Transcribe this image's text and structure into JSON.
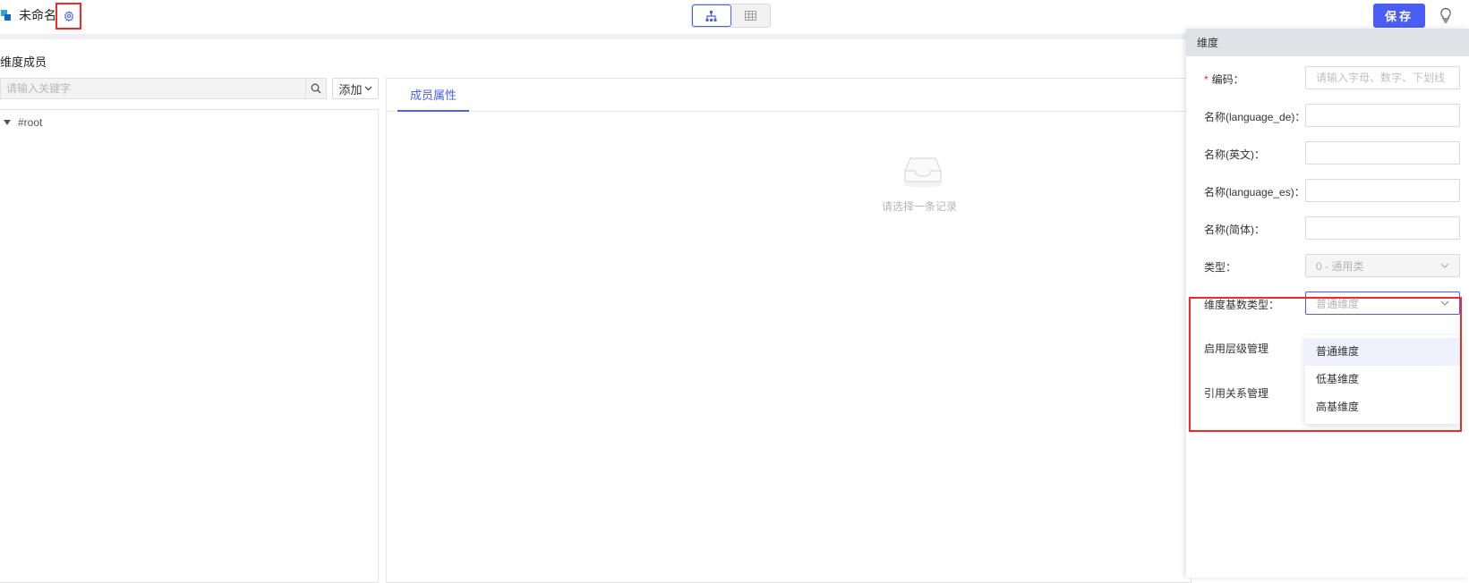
{
  "header": {
    "title": "未命名",
    "save_label": "保存",
    "colors": {
      "accent": "#4b5ef4",
      "highlight": "#f02a2a"
    },
    "icons": [
      "cube-logo-icon",
      "gear-icon",
      "tree-view-icon",
      "table-view-icon",
      "lightbulb-icon"
    ]
  },
  "left_panel": {
    "title": "维度成员",
    "search": {
      "placeholder": "请输入关键字",
      "value": ""
    },
    "add_label": "添加",
    "tree": [
      {
        "label": "#root",
        "expanded": true
      }
    ]
  },
  "detail": {
    "tabs": [
      {
        "label": "成员属性",
        "active": true
      }
    ],
    "empty_text": "请选择一条记录"
  },
  "drawer": {
    "title": "维度",
    "fields": [
      {
        "label": "编码：",
        "required": true,
        "placeholder": "请输入字母、数字、下划线",
        "value": ""
      },
      {
        "label": "名称(language_de)：",
        "value": ""
      },
      {
        "label": "名称(英文)：",
        "value": ""
      },
      {
        "label": "名称(language_es)：",
        "value": ""
      },
      {
        "label": "名称(简体)：",
        "value": ""
      },
      {
        "label": "类型：",
        "value": "0 - 通用类",
        "disabled": true
      },
      {
        "label": "维度基数类型：",
        "value": "普通维度",
        "focused": true
      },
      {
        "label": "启用层级管理"
      },
      {
        "label": "引用关系管理"
      }
    ],
    "dropdown_options": [
      "普通维度",
      "低基维度",
      "高基维度"
    ],
    "dropdown_selected": "普通维度"
  }
}
